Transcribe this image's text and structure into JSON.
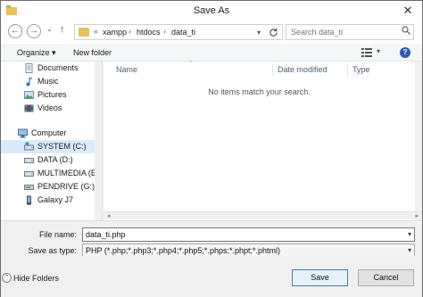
{
  "window": {
    "title": "Save As",
    "close_glyph": "✕"
  },
  "nav": {
    "back_glyph": "←",
    "forward_glyph": "→",
    "recent_glyph": "⌄",
    "up_glyph": "↑",
    "path_prefix": "«",
    "breadcrumbs": [
      "xampp",
      "htdocs",
      "data_ti"
    ],
    "separator": "›",
    "search_placeholder": "Search data_ti"
  },
  "toolbar": {
    "organize_label": "Organize ▾",
    "new_folder_label": "New folder",
    "view_dd": "▾",
    "help": "?"
  },
  "sidebar": {
    "items": [
      {
        "label": "Documents",
        "icon": "documents-icon"
      },
      {
        "label": "Music",
        "icon": "music-icon"
      },
      {
        "label": "Pictures",
        "icon": "pictures-icon"
      },
      {
        "label": "Videos",
        "icon": "videos-icon"
      },
      {
        "label": "Computer",
        "icon": "computer-icon"
      },
      {
        "label": "SYSTEM (C:)",
        "icon": "drive-c-icon"
      },
      {
        "label": "DATA (D:)",
        "icon": "drive-icon"
      },
      {
        "label": "MULTIMEDIA (E:)",
        "icon": "drive-icon"
      },
      {
        "label": "PENDRIVE (G:)",
        "icon": "usb-drive-icon"
      },
      {
        "label": "Galaxy J7",
        "icon": "phone-icon"
      }
    ]
  },
  "columns": {
    "name": "Name",
    "date_modified": "Date modified",
    "type": "Type"
  },
  "empty_message": "No items match your search.",
  "form": {
    "file_name_label": "File name:",
    "file_name_value": "data_ti.php",
    "save_as_type_label": "Save as type:",
    "save_as_type_value": "PHP (*.php;*.php3;*.php4;*.php5;*.phps;*.phpt;*.phtml)",
    "dd_glyph": "▾"
  },
  "footer": {
    "hide_folders_label": "Hide Folders",
    "save_label": "Save",
    "cancel_label": "Cancel"
  },
  "colors": {
    "accent": "#2a5db0",
    "selection": "#d9ebfb",
    "folder": "#e8c15a"
  }
}
